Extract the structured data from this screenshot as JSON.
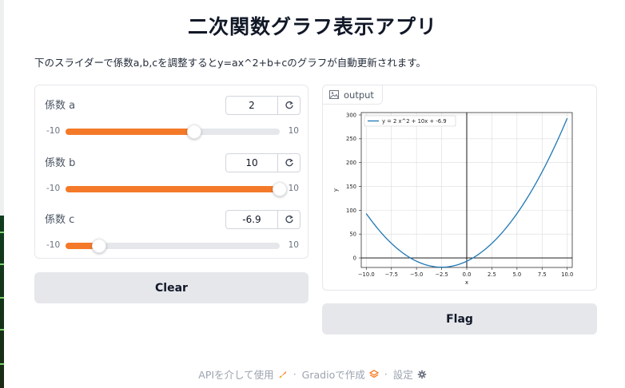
{
  "app": {
    "title": "二次関数グラフ表示アプリ",
    "description": "下のスライダーで係数a,b,cを調整するとy=ax^2+b+cのグラフが自動更新されます。"
  },
  "sliders": [
    {
      "label": "係数 a",
      "value": "2",
      "min": -10,
      "max": 10,
      "min_label": "-10",
      "max_label": "10"
    },
    {
      "label": "係数 b",
      "value": "10",
      "min": -10,
      "max": 10,
      "min_label": "-10",
      "max_label": "10"
    },
    {
      "label": "係数 c",
      "value": "-6.9",
      "min": -10,
      "max": 10,
      "min_label": "-10",
      "max_label": "10"
    }
  ],
  "buttons": {
    "clear": "Clear",
    "flag": "Flag"
  },
  "output": {
    "label": "output"
  },
  "footer": {
    "api": "APIを介して使用",
    "gradio": "Gradioで作成",
    "settings": "設定",
    "sep": "·"
  },
  "colors": {
    "accent": "#f47a29",
    "line": "#1f77b4",
    "button_bg": "#e5e7eb"
  },
  "chart_data": {
    "type": "line",
    "title": "",
    "xlabel": "x",
    "ylabel": "y",
    "xlim": [
      -10.5,
      10.5
    ],
    "ylim": [
      -20,
      305
    ],
    "xticks": [
      -10,
      -7.5,
      -5,
      -2.5,
      0,
      2.5,
      5,
      7.5,
      10
    ],
    "xtick_labels": [
      "−10.0",
      "−7.5",
      "−5.0",
      "−2.5",
      "0.0",
      "2.5",
      "5.0",
      "7.5",
      "10.0"
    ],
    "yticks": [
      0,
      50,
      100,
      150,
      200,
      250,
      300
    ],
    "ytick_labels": [
      "0",
      "50",
      "100",
      "150",
      "200",
      "250",
      "300"
    ],
    "grid": true,
    "legend": "upper-left",
    "series": [
      {
        "name": "y = 2 x^2 + 10x + -6.9",
        "a": 2,
        "b": 10,
        "c": -6.9,
        "x_range": [
          -10,
          10
        ]
      }
    ]
  }
}
